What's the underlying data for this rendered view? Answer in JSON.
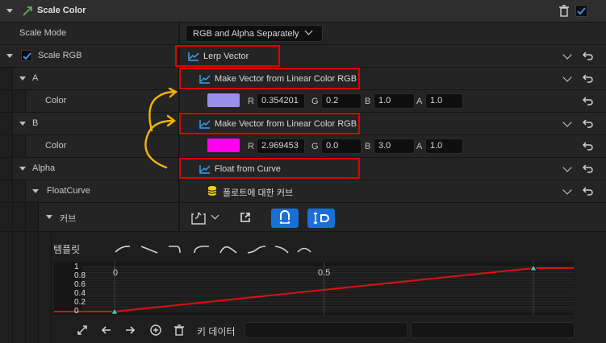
{
  "header": {
    "title": "Scale Color"
  },
  "scale_mode": {
    "label": "Scale Mode",
    "value": "RGB and Alpha Separately"
  },
  "scale_rgb": {
    "label": "Scale RGB",
    "node": "Lerp Vector"
  },
  "a": {
    "label": "A",
    "node": "Make Vector from Linear Color RGB",
    "color_label": "Color",
    "swatch": "#9b8ee8",
    "r_label": "R",
    "r": "0.354201",
    "g_label": "G",
    "g": "0.2",
    "b_label": "B",
    "b": "1.0",
    "a_label": "A",
    "a": "1.0"
  },
  "b": {
    "label": "B",
    "node": "Make Vector from Linear Color RGB",
    "color_label": "Color",
    "swatch": "#ff00ee",
    "r_label": "R",
    "r": "2.969453",
    "g_label": "G",
    "g": "0.0",
    "b_label": "B",
    "b": "3.0",
    "a_label": "A",
    "a": "1.0"
  },
  "alpha": {
    "label": "Alpha",
    "node": "Float from Curve"
  },
  "float_curve": {
    "label": "FloatCurve",
    "asset": "플로트에 대한 커브"
  },
  "curve": {
    "label": "커브",
    "template_label": "템플릿"
  },
  "chart_axes": {
    "y_ticks": [
      "1",
      "0.8",
      "0.6",
      "0.4",
      "0.2",
      "0"
    ],
    "x_ticks": [
      "0",
      "0.5"
    ]
  },
  "key_bar": {
    "label": "키 데이터",
    "field1": "",
    "field2": ""
  },
  "chart_data": {
    "type": "line",
    "x": [
      0,
      1
    ],
    "y": [
      0,
      1
    ],
    "ylim": [
      0,
      1
    ],
    "grid": true,
    "keys": [
      {
        "x": 0,
        "y": 0
      },
      {
        "x": 1,
        "y": 1
      }
    ]
  }
}
